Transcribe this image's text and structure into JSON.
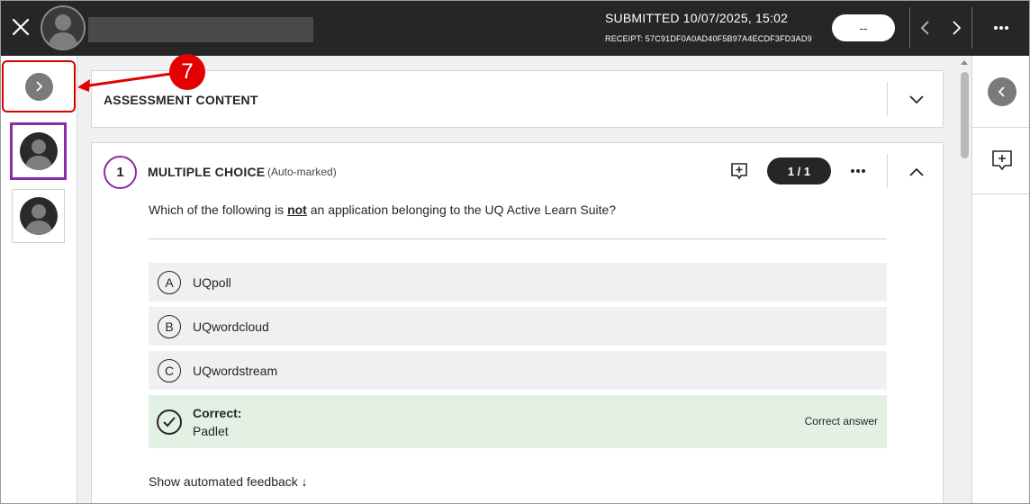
{
  "header": {
    "submitted": "SUBMITTED 10/07/2025, 15:02",
    "receipt": "RECEIPT: 57C91DF0A0AD40F5B97A4ECDF3FD3AD9",
    "grade_value": "--"
  },
  "assessment": {
    "section_title": "ASSESSMENT CONTENT"
  },
  "question": {
    "number": "1",
    "type": "MULTIPLE CHOICE",
    "auto_label": "(Auto-marked)",
    "score": "1 / 1",
    "prompt_before": "Which of the following is ",
    "prompt_emph": "not",
    "prompt_after": " an application belonging to the UQ Active Learn Suite?",
    "options": [
      {
        "letter": "A",
        "text": "UQpoll"
      },
      {
        "letter": "B",
        "text": "UQwordcloud"
      },
      {
        "letter": "C",
        "text": "UQwordstream"
      }
    ],
    "correct": {
      "label": "Correct:",
      "text": "Padlet",
      "tag": "Correct answer"
    },
    "feedback_link": "Show automated feedback ↓"
  },
  "annotation": {
    "number": "7"
  },
  "icons": [
    "close-icon",
    "avatar-icon",
    "chevron-left-icon",
    "chevron-right-icon",
    "more-icon",
    "chevron-down-icon",
    "chevron-up-icon",
    "add-comment-icon",
    "check-icon"
  ],
  "colors": {
    "header_bg": "#262626",
    "accent_purple": "#8a2ca8",
    "annotation_red": "#e20000",
    "correct_bg": "#e3f1e4"
  }
}
